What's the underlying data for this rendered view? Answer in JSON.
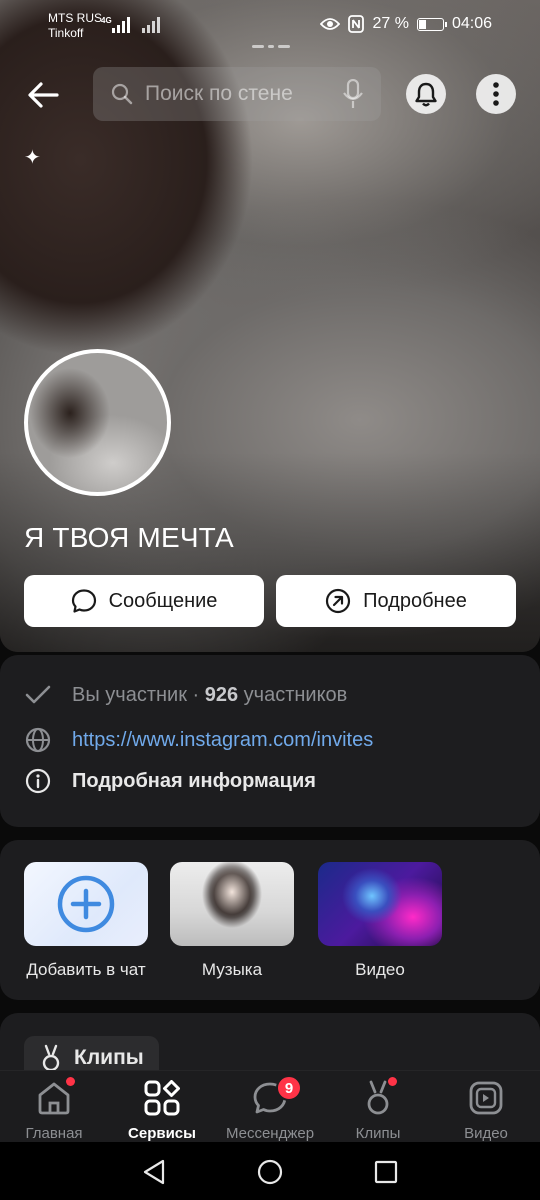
{
  "status_bar": {
    "carrier_1": "MTS RUS",
    "carrier_2": "Tinkoff",
    "network": "4G",
    "battery": "27 %",
    "time": "04:06"
  },
  "toolbar": {
    "search_placeholder": "Поиск по стене"
  },
  "group": {
    "name": "Я ТВОЯ МЕЧТА",
    "message_button": "Сообщение",
    "details_button": "Подробнее"
  },
  "info": {
    "membership_prefix": "Вы участник · ",
    "members_count": "926",
    "members_suffix": " участников",
    "link": "https://www.instagram.com/invites",
    "details": "Подробная информация"
  },
  "services": [
    {
      "label": "Добавить в чат",
      "icon": "plus-icon"
    },
    {
      "label": "Музыка",
      "icon": "music-thumbnail"
    },
    {
      "label": "Видео",
      "icon": "video-thumbnail"
    }
  ],
  "clips_section": {
    "label": "Клипы"
  },
  "bottom_nav": [
    {
      "label": "Главная",
      "icon": "home-icon",
      "dot": true
    },
    {
      "label": "Сервисы",
      "icon": "services-icon",
      "active": true
    },
    {
      "label": "Мессенджер",
      "icon": "messenger-icon",
      "badge": "9"
    },
    {
      "label": "Клипы",
      "icon": "clips-icon",
      "dot": true
    },
    {
      "label": "Видео",
      "icon": "video-icon"
    }
  ],
  "colors": {
    "accent_link": "#71aaeb",
    "badge": "#ff3347",
    "card": "#1d1d1f"
  }
}
